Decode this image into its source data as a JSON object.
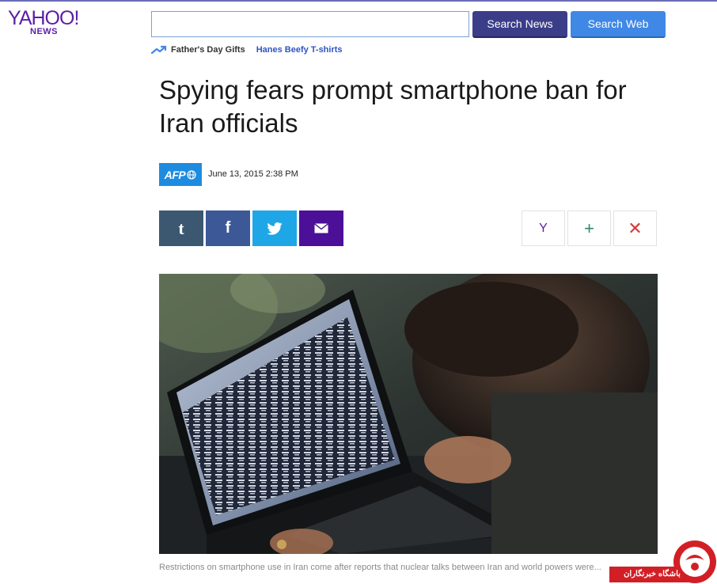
{
  "header": {
    "logo_text": "YAHOO!",
    "logo_sub": "NEWS",
    "search_value": "",
    "search_news_label": "Search News",
    "search_web_label": "Search Web"
  },
  "trending": {
    "items": [
      "Father's Day Gifts",
      "Hanes Beefy T-shirts"
    ]
  },
  "article": {
    "title": "Spying fears prompt smartphone ban for Iran officials",
    "source_logo_text": "AFP",
    "date": "June 13, 2015 2:38 PM",
    "caption": "Restrictions on smartphone use in Iran come after reports that nuclear talks between Iran and world powers were..."
  },
  "share_buttons": [
    {
      "name": "tumblr",
      "glyph": "t"
    },
    {
      "name": "facebook",
      "glyph": "f"
    },
    {
      "name": "twitter",
      "icon": "twitter-bird-icon"
    },
    {
      "name": "email",
      "icon": "envelope-icon"
    }
  ],
  "tools": {
    "yahoo_glyph": "Y",
    "add_glyph": "+",
    "close_glyph": "✕"
  },
  "watermark": {
    "text": "باشگاه خبرنگاران"
  },
  "colors": {
    "brand_purple": "#5a1fa6",
    "search_news_bg": "#3b3d89",
    "search_web_bg": "#3f88e6",
    "tumblr": "#3c5871",
    "facebook": "#3c5897",
    "twitter": "#1ea6e6",
    "mail": "#4c0f98",
    "afp_blue": "#1d8ce0",
    "watermark_red": "#d21f26"
  }
}
